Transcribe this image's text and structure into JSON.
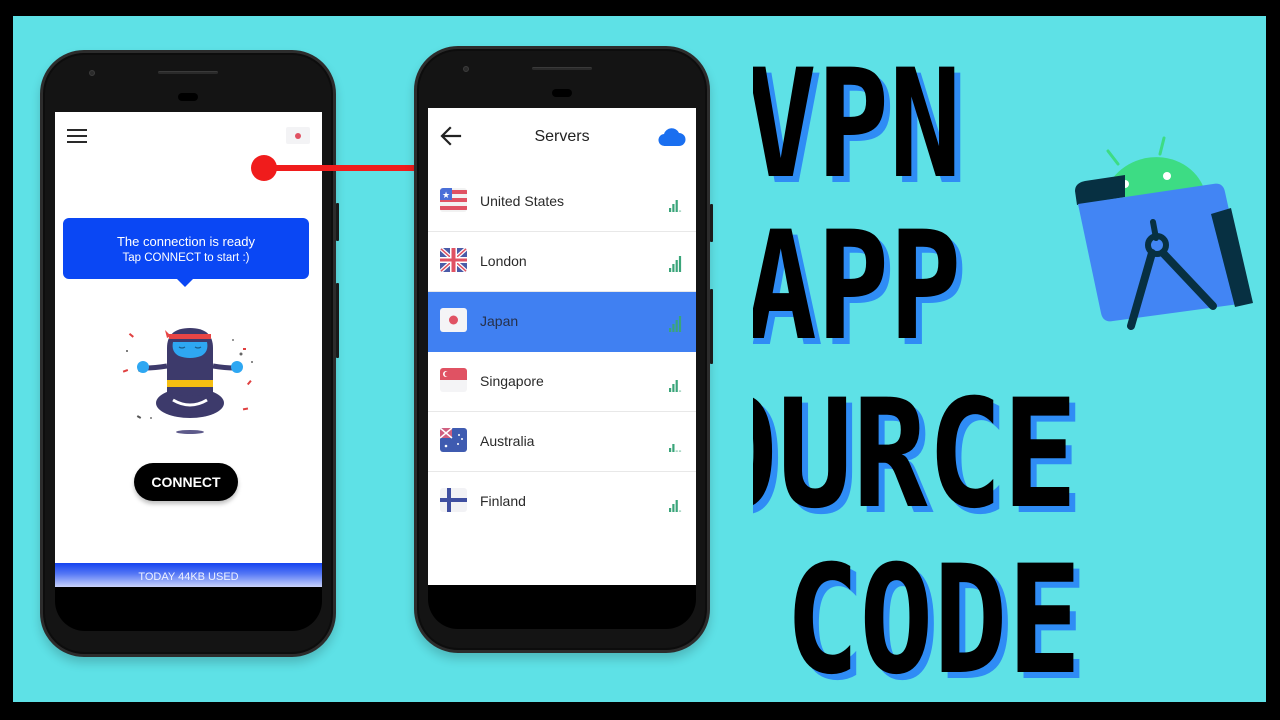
{
  "thumbnail": {
    "title_lines": [
      "VPN",
      "APP",
      "SOURCE",
      "CODE"
    ],
    "colors": {
      "background": "#5ee1e6",
      "title_text": "#000000",
      "title_shadow": "#2f8cf5",
      "arrow": "#f01c1c",
      "android_green": "#3ddc84",
      "studio_blue": "#4285f4",
      "studio_navy": "#073042"
    },
    "logo": "android-studio-logo"
  },
  "home_screen": {
    "menu_icon": "hamburger-menu-icon",
    "selected_flag": "japan-flag-icon",
    "tooltip": {
      "line1": "The connection is ready",
      "line2": "Tap CONNECT to start :)"
    },
    "illustration": "meditating-ninja",
    "connect_label": "CONNECT",
    "usage_text": "TODAY 44KB USED",
    "colors": {
      "tooltip_bg": "#0a47f4",
      "button_bg": "#000000"
    }
  },
  "servers_screen": {
    "title": "Servers",
    "back_icon": "arrow-left-icon",
    "action_icon": "cloud-icon",
    "selected_color": "#4080f2",
    "signal_color": "#3aa57a",
    "servers": [
      {
        "name": "United States",
        "flag": "us",
        "signal_bars": 3,
        "max_bars": 4,
        "selected": false
      },
      {
        "name": "London",
        "flag": "uk",
        "signal_bars": 4,
        "max_bars": 4,
        "selected": false
      },
      {
        "name": "Japan",
        "flag": "jp",
        "signal_bars": 4,
        "max_bars": 4,
        "selected": true
      },
      {
        "name": "Singapore",
        "flag": "sg",
        "signal_bars": 3,
        "max_bars": 4,
        "selected": false
      },
      {
        "name": "Australia",
        "flag": "au",
        "signal_bars": 2,
        "max_bars": 4,
        "selected": false
      },
      {
        "name": "Finland",
        "flag": "fi",
        "signal_bars": 3,
        "max_bars": 4,
        "selected": false
      }
    ]
  }
}
